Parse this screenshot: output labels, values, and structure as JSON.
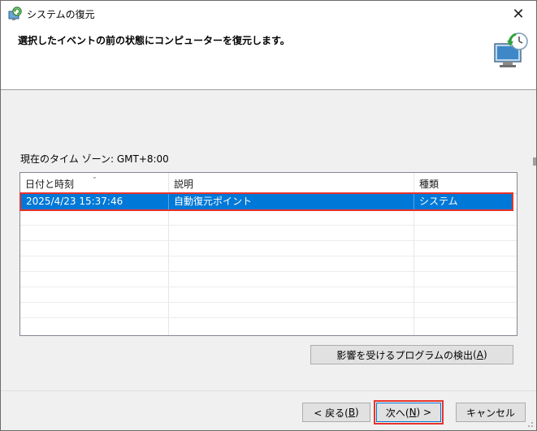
{
  "window": {
    "title": "システムの復元",
    "close_glyph": "✕"
  },
  "header": {
    "instruction": "選択したイベントの前の状態にコンピューターを復元します。"
  },
  "timezone_label": "現在のタイム ゾーン: GMT+8:00",
  "table": {
    "columns": [
      "日付と時刻",
      "説明",
      "種類"
    ],
    "sort_glyph": "⌄",
    "rows": [
      {
        "datetime": "2025/4/23 15:37:46",
        "description": "自動復元ポイント",
        "type": "システム",
        "selected": true
      }
    ]
  },
  "buttons": {
    "affected_programs": {
      "label": "影響を受けるプログラムの検出",
      "accel": "A"
    },
    "back": {
      "prefix": "< 戻る(",
      "accel": "B",
      "suffix": ")"
    },
    "next": {
      "prefix": "次へ(",
      "accel": "N",
      "suffix": ") >"
    },
    "cancel": "キャンセル"
  },
  "icons": {
    "app": "system-restore-icon",
    "hero": "system-restore-monitor-icon",
    "close": "close-icon"
  },
  "colors": {
    "selection": "#0078d7",
    "highlight_outline": "#e8332b"
  }
}
